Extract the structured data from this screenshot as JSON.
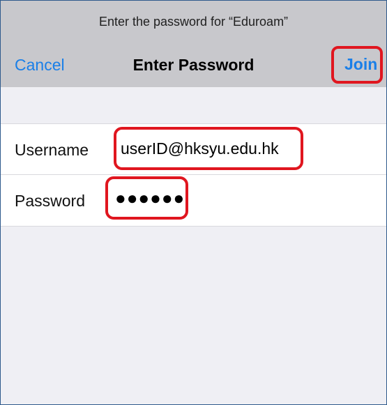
{
  "header": {
    "prompt": "Enter the password for “Eduroam”",
    "cancel_label": "Cancel",
    "title": "Enter Password",
    "join_label": "Join"
  },
  "form": {
    "username": {
      "label": "Username",
      "value": "userID@hksyu.edu.hk"
    },
    "password": {
      "label": "Password",
      "value": "●●●●●●"
    }
  },
  "colors": {
    "accent": "#1a7fe8",
    "highlight": "#e0161f",
    "header_bg": "#c8c8cc",
    "page_bg": "#efeff4"
  }
}
